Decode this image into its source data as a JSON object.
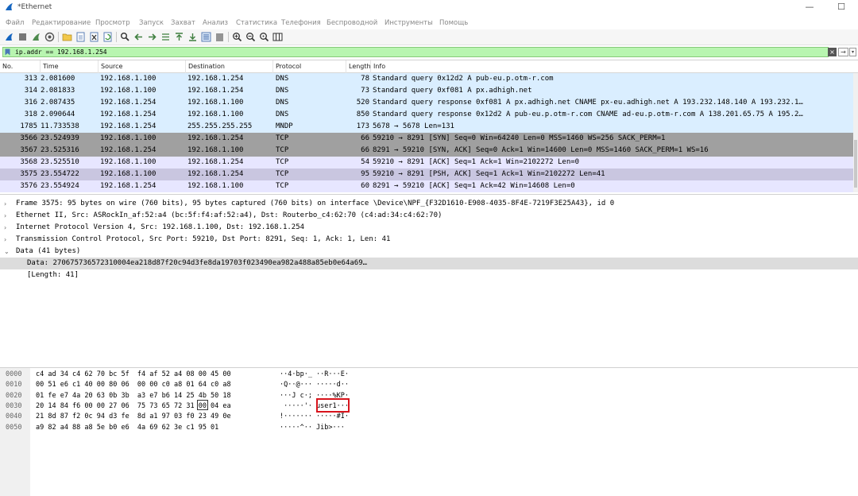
{
  "window": {
    "title": "*Ethernet",
    "minimize_glyph": "—",
    "maximize_glyph": "☐",
    "app_icon": "shark-fin-icon"
  },
  "menu": [
    "Файл",
    "Редактирование",
    "Просмотр",
    "Запуск",
    "Захват",
    "Анализ",
    "Статистика",
    "Телефония",
    "Беспроводной",
    "Инструменты",
    "Помощь"
  ],
  "filter": {
    "value": "ip.addr == 192.168.1.254",
    "clear_glyph": "×",
    "apply_glyph": "→",
    "dropdown_glyph": "▾"
  },
  "packet_list": {
    "columns": [
      "No.",
      "Time",
      "Source",
      "Destination",
      "Protocol",
      "Length",
      "Info"
    ],
    "rows": [
      {
        "no": "313",
        "time": "2.081600",
        "src": "192.168.1.100",
        "dst": "192.168.1.254",
        "proto": "DNS",
        "len": "78",
        "info": "Standard query 0x12d2 A pub-eu.p.otm-r.com",
        "kind": "dns"
      },
      {
        "no": "314",
        "time": "2.081833",
        "src": "192.168.1.100",
        "dst": "192.168.1.254",
        "proto": "DNS",
        "len": "73",
        "info": "Standard query 0xf081 A px.adhigh.net",
        "kind": "dns"
      },
      {
        "no": "316",
        "time": "2.087435",
        "src": "192.168.1.254",
        "dst": "192.168.1.100",
        "proto": "DNS",
        "len": "520",
        "info": "Standard query response 0xf081 A px.adhigh.net CNAME px-eu.adhigh.net A 193.232.148.140 A 193.232.1…",
        "kind": "dns"
      },
      {
        "no": "318",
        "time": "2.090644",
        "src": "192.168.1.254",
        "dst": "192.168.1.100",
        "proto": "DNS",
        "len": "850",
        "info": "Standard query response 0x12d2 A pub-eu.p.otm-r.com CNAME ad-eu.p.otm-r.com A 138.201.65.75 A 195.2…",
        "kind": "dns"
      },
      {
        "no": "1785",
        "time": "11.733538",
        "src": "192.168.1.254",
        "dst": "255.255.255.255",
        "proto": "MNDP",
        "len": "173",
        "info": "5678 → 5678 Len=131",
        "kind": "dns"
      },
      {
        "no": "3566",
        "time": "23.524939",
        "src": "192.168.1.100",
        "dst": "192.168.1.254",
        "proto": "TCP",
        "len": "66",
        "info": "59210 → 8291 [SYN] Seq=0 Win=64240 Len=0 MSS=1460 WS=256 SACK_PERM=1",
        "kind": "syn"
      },
      {
        "no": "3567",
        "time": "23.525316",
        "src": "192.168.1.254",
        "dst": "192.168.1.100",
        "proto": "TCP",
        "len": "66",
        "info": "8291 → 59210 [SYN, ACK] Seq=0 Ack=1 Win=14600 Len=0 MSS=1460 SACK_PERM=1 WS=16",
        "kind": "syn"
      },
      {
        "no": "3568",
        "time": "23.525510",
        "src": "192.168.1.100",
        "dst": "192.168.1.254",
        "proto": "TCP",
        "len": "54",
        "info": "59210 → 8291 [ACK] Seq=1 Ack=1 Win=2102272 Len=0",
        "kind": "tcp"
      },
      {
        "no": "3575",
        "time": "23.554722",
        "src": "192.168.1.100",
        "dst": "192.168.1.254",
        "proto": "TCP",
        "len": "95",
        "info": "59210 → 8291 [PSH, ACK] Seq=1 Ack=1 Win=2102272 Len=41",
        "kind": "selected"
      },
      {
        "no": "3576",
        "time": "23.554924",
        "src": "192.168.1.254",
        "dst": "192.168.1.100",
        "proto": "TCP",
        "len": "60",
        "info": "8291 → 59210 [ACK] Seq=1 Ack=42 Win=14608 Len=0",
        "kind": "tcp"
      }
    ]
  },
  "details": [
    {
      "caret": "›",
      "indent": 0,
      "text": "Frame 3575: 95 bytes on wire (760 bits), 95 bytes captured (760 bits) on interface \\Device\\NPF_{F32D1610-E908-4035-8F4E-7219F3E25A43}, id 0"
    },
    {
      "caret": "›",
      "indent": 0,
      "text": "Ethernet II, Src: ASRockIn_af:52:a4 (bc:5f:f4:af:52:a4), Dst: Routerbo_c4:62:70 (c4:ad:34:c4:62:70)"
    },
    {
      "caret": "›",
      "indent": 0,
      "text": "Internet Protocol Version 4, Src: 192.168.1.100, Dst: 192.168.1.254"
    },
    {
      "caret": "›",
      "indent": 0,
      "text": "Transmission Control Protocol, Src Port: 59210, Dst Port: 8291, Seq: 1, Ack: 1, Len: 41"
    },
    {
      "caret": "⌄",
      "indent": 0,
      "text": "Data (41 bytes)"
    },
    {
      "caret": "",
      "indent": 1,
      "text": "Data: 270675736572310004ea218d87f20c94d3fe8da19703f023490ea982a488a85eb0e64a69…",
      "selected": true
    },
    {
      "caret": "",
      "indent": 1,
      "text": "[Length: 41]"
    }
  ],
  "bytes": [
    {
      "offset": "0000",
      "hex": "c4 ad 34 c4 62 70 bc 5f  f4 af 52 a4 08 00 45 00",
      "ascii": "··4·bp·_ ··R···E·"
    },
    {
      "offset": "0010",
      "hex": "00 51 e6 c1 40 00 80 06  00 00 c0 a8 01 64 c0 a8",
      "ascii": "·Q··@··· ·····d··"
    },
    {
      "offset": "0020",
      "hex": "01 fe e7 4a 20 63 0b 3b  a3 e7 b6 14 25 4b 50 18",
      "ascii": "···J c·; ····%KP·"
    },
    {
      "offset": "0030",
      "hex": "20 14 84 f6 00 00 27 06  75 73 65 72 31 00 04 ea",
      "ascii": " ·····'· user1···"
    },
    {
      "offset": "0040",
      "hex": "21 8d 87 f2 0c 94 d3 fe  8d a1 97 03 f0 23 49 0e",
      "ascii": "!······· ·····#I·"
    },
    {
      "offset": "0050",
      "hex": "a9 82 a4 88 a8 5e b0 e6  4a 69 62 3e c1 95 01",
      "ascii": "·····^·· Jib>···"
    }
  ],
  "colors": {
    "dns_row": "#daeeff",
    "syn_row": "#a0a0a0",
    "tcp_row": "#e7e6ff",
    "selected_row": "#c9c6e0",
    "filter_bg": "#b8f5b0",
    "highlight_box": "#d8141c"
  }
}
